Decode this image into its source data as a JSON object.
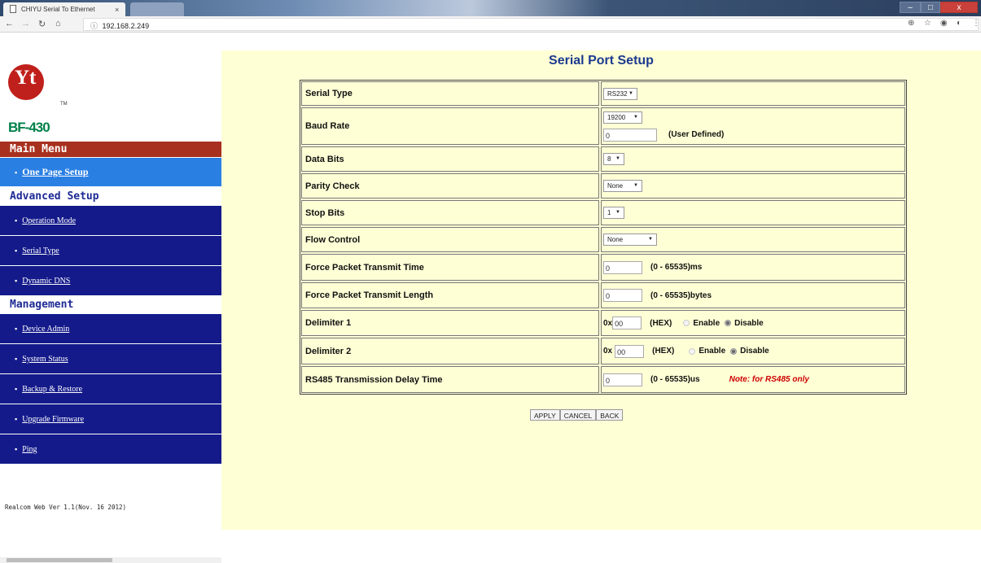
{
  "browser": {
    "tab_title": "CHIYU Serial To Ethernet",
    "tab_close": "×",
    "url": "192.168.2.249",
    "url_info_icon": "ⓘ",
    "window_controls": {
      "minimize": "–",
      "maximize": "□",
      "close": "x"
    }
  },
  "sidebar": {
    "logo_text": "Yt",
    "trademark": "TM",
    "model": "BF-430",
    "main_menu": "Main Menu",
    "one_page_setup": "One Page Setup",
    "advanced_setup": "Advanced Setup",
    "advanced_items": [
      "Operation Mode",
      "Serial Type",
      "Dynamic DNS"
    ],
    "management": "Management",
    "management_items": [
      "Device Admin",
      "System Status",
      "Backup & Restore",
      "Upgrade Firmware",
      "Ping"
    ],
    "version": "Realcom Web Ver 1.1(Nov. 16 2012)"
  },
  "page": {
    "title": "Serial Port Setup",
    "labels": {
      "serial_type": "Serial Type",
      "baud_rate": "Baud Rate",
      "data_bits": "Data Bits",
      "parity_check": "Parity Check",
      "stop_bits": "Stop Bits",
      "flow_control": "Flow Control",
      "force_time": "Force Packet Transmit Time",
      "force_length": "Force Packet Transmit Length",
      "delimiter1": "Delimiter 1",
      "delimiter2": "Delimiter 2",
      "rs485_delay": "RS485 Transmission Delay Time"
    },
    "values": {
      "serial_type": "RS232",
      "baud_rate": "19200",
      "baud_user": "0",
      "baud_user_label": "(User Defined)",
      "data_bits": "8",
      "parity_check": "None",
      "stop_bits": "1",
      "flow_control": "None",
      "force_time": "0",
      "force_time_range": "(0 - 65535)ms",
      "force_length": "0",
      "force_length_range": "(0 - 65535)bytes",
      "delim1_prefix": "0x",
      "delim1_value": "00",
      "delim2_prefix": "0x",
      "delim2_value": "00",
      "hex_label": "(HEX)",
      "enable": "Enable",
      "disable": "Disable",
      "rs485_delay": "0",
      "rs485_range": "(0 - 65535)us",
      "rs485_note": "Note: for RS485 only"
    },
    "buttons": {
      "apply": "APPLY",
      "cancel": "CANCEL",
      "back": "BACK"
    }
  },
  "colors": {
    "main_bg": "#ffffd6",
    "nav_bg": "#141a8a",
    "nav_active_bg": "#2a7fe3",
    "main_menu_bg": "#a8301f",
    "model_green": "#00804a",
    "title_blue": "#1c3a8f"
  }
}
